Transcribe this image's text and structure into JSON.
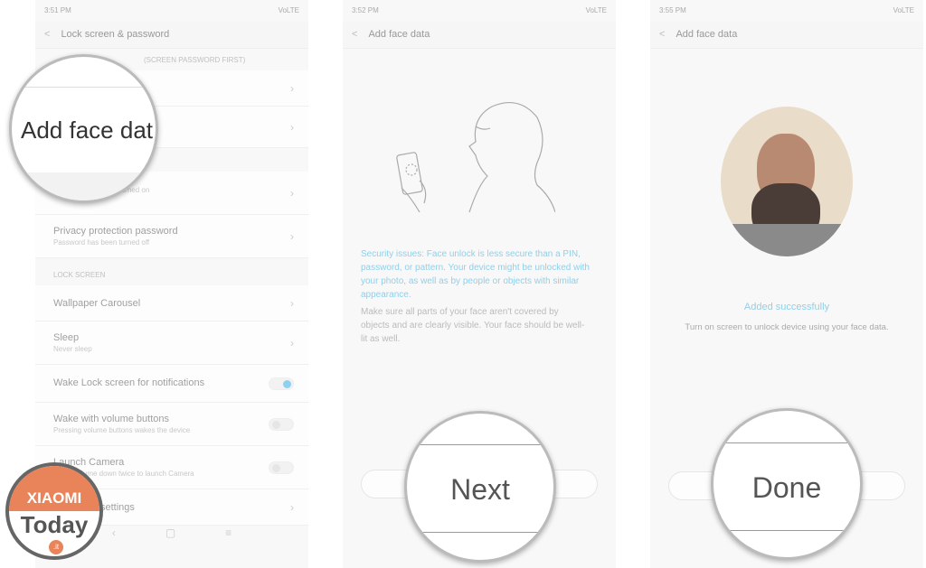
{
  "screen1": {
    "time": "3:51 PM",
    "status": "VoLTE",
    "title": "Lock screen & password",
    "section_top": "(SCREEN PASSWORD FIRST)",
    "magnified": "Add face dat",
    "rows": [
      {
        "title": "",
        "sub": "Password has been turned on"
      },
      {
        "title": "Privacy protection password",
        "sub": "Password has been turned off"
      }
    ],
    "lock_section": "LOCK SCREEN",
    "lock_rows": [
      {
        "title": "Wallpaper Carousel",
        "sub": "",
        "type": "chevron"
      },
      {
        "title": "Sleep",
        "sub": "Never sleep",
        "type": "chevron"
      },
      {
        "title": "Wake Lock screen for notifications",
        "sub": "",
        "type": "toggle",
        "on": true
      },
      {
        "title": "Wake with volume buttons",
        "sub": "Pressing volume buttons wakes the device",
        "type": "toggle",
        "on": false
      },
      {
        "title": "Launch Camera",
        "sub": "Press volume down twice to launch Camera",
        "type": "toggle",
        "on": false
      },
      {
        "title": "Advanced settings",
        "sub": "",
        "type": "chevron"
      }
    ]
  },
  "screen2": {
    "time": "3:52 PM",
    "status": "VoLTE",
    "title": "Add face data",
    "warning": "Security issues: Face unlock is less secure than a PIN, password, or pattern. Your device might be unlocked with your photo, as well as by people or objects with similar appearance.",
    "tip": "Make sure all parts of your face aren't covered by objects and are clearly visible. Your face should be well-lit as well.",
    "button": "Next"
  },
  "screen3": {
    "time": "3:55 PM",
    "status": "VoLTE",
    "title": "Add face data",
    "success": "Added successfully",
    "desc": "Turn on screen to unlock device using your face data.",
    "button": "Done"
  },
  "logo": {
    "line1": "XIAOMI",
    "line2": "Today",
    "suffix": ".it",
    "color": "#e8835a"
  },
  "colors": {
    "accent": "#8fd0ea"
  }
}
